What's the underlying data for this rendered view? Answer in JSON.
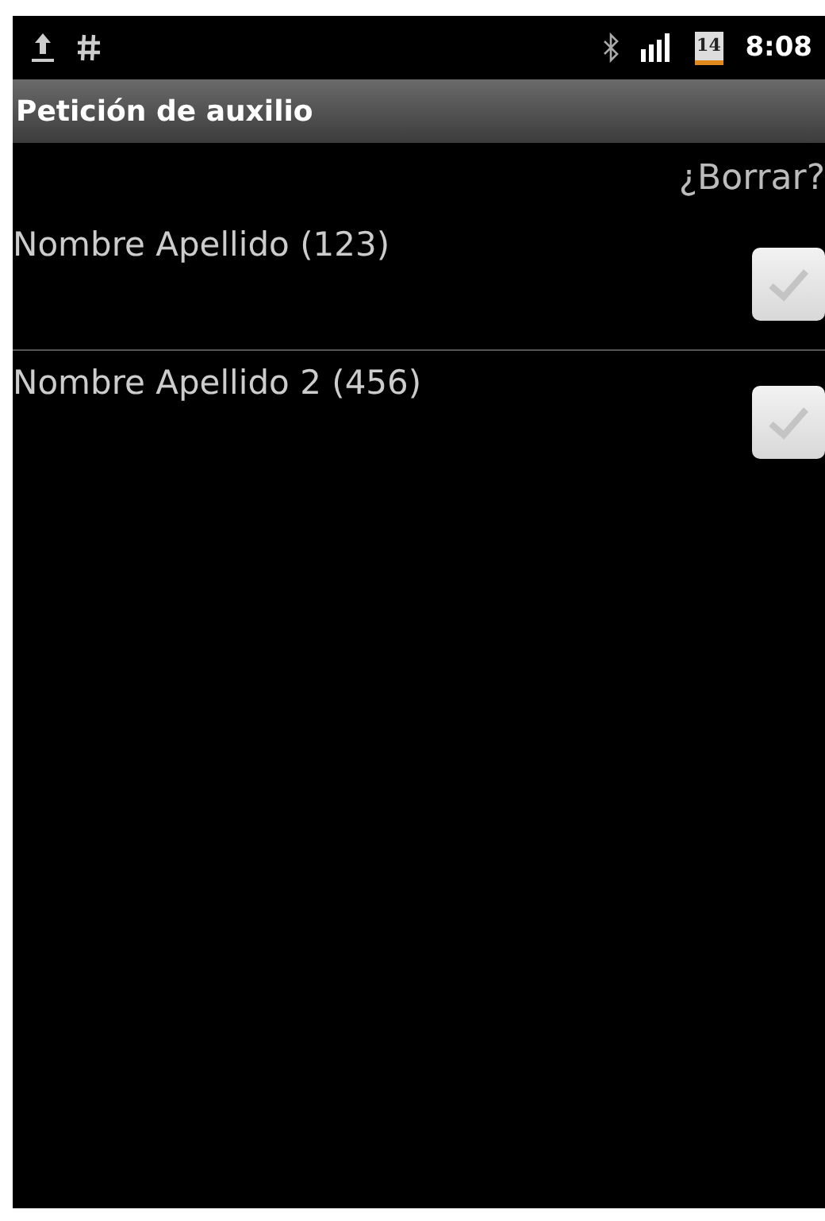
{
  "status_bar": {
    "time": "8:08",
    "calendar_day": "14"
  },
  "title_bar": {
    "title": "Petición de auxilio"
  },
  "header": {
    "label": "¿Borrar?"
  },
  "contacts": [
    {
      "name": "Nombre Apellido (123)",
      "checked": false
    },
    {
      "name": "Nombre Apellido 2 (456)",
      "checked": false
    }
  ]
}
